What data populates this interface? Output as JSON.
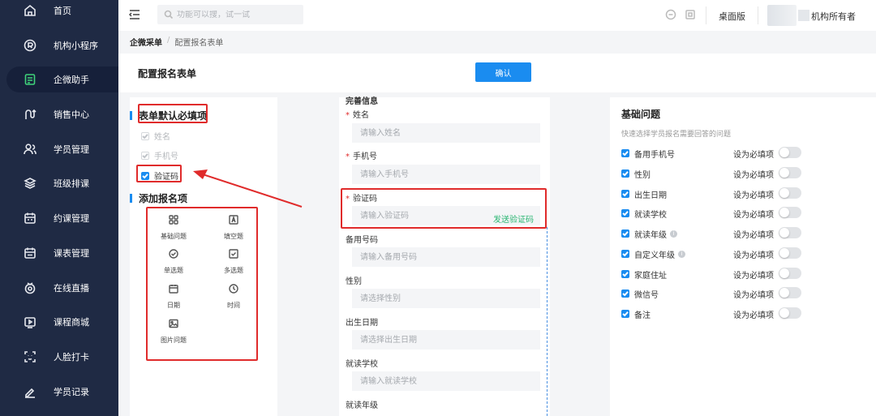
{
  "sidebar": {
    "items": [
      {
        "label": "首页",
        "icon": "home-icon"
      },
      {
        "label": "机构小程序",
        "icon": "mini-program-icon"
      },
      {
        "label": "企微助手",
        "icon": "assistant-icon",
        "active": true
      },
      {
        "label": "销售中心",
        "icon": "sales-icon"
      },
      {
        "label": "学员管理",
        "icon": "students-icon"
      },
      {
        "label": "班级排课",
        "icon": "class-icon"
      },
      {
        "label": "约课管理",
        "icon": "booking-icon"
      },
      {
        "label": "课表管理",
        "icon": "calendar-icon"
      },
      {
        "label": "在线直播",
        "icon": "live-icon"
      },
      {
        "label": "课程商城",
        "icon": "mall-icon"
      },
      {
        "label": "人脸打卡",
        "icon": "face-scan-icon"
      },
      {
        "label": "学员记录",
        "icon": "record-icon"
      }
    ]
  },
  "topbar": {
    "search_placeholder": "功能可以搜，试一试",
    "desktop_label": "桌面版",
    "owner_label": "机构所有者"
  },
  "breadcrumb": {
    "first": "企微采单",
    "sep": "/",
    "current": "配置报名表单"
  },
  "header": {
    "title": "配置报名表单",
    "confirm_label": "确认"
  },
  "left": {
    "required_title": "表单默认必填项",
    "required_items": [
      {
        "label": "姓名",
        "state": "disabled"
      },
      {
        "label": "手机号",
        "state": "disabled"
      },
      {
        "label": "验证码",
        "state": "checked"
      }
    ],
    "add_title": "添加报名项",
    "tools": [
      {
        "label": "基础问题",
        "icon": "grid-icon"
      },
      {
        "label": "填空题",
        "icon": "text-box-icon"
      },
      {
        "label": "单选题",
        "icon": "radio-circle-icon"
      },
      {
        "label": "多选题",
        "icon": "checkbox-icon"
      },
      {
        "label": "日期",
        "icon": "date-icon"
      },
      {
        "label": "时间",
        "icon": "clock-icon"
      },
      {
        "label": "图片问题",
        "icon": "image-icon"
      }
    ]
  },
  "form": {
    "head": "完善信息",
    "fields": [
      {
        "label": "姓名",
        "required": true,
        "placeholder": "请输入姓名"
      },
      {
        "label": "手机号",
        "required": true,
        "placeholder": "请输入手机号"
      },
      {
        "label": "验证码",
        "required": true,
        "placeholder": "请输入验证码"
      },
      {
        "label": "备用号码",
        "required": false,
        "placeholder": "请输入备用号码"
      },
      {
        "label": "性别",
        "required": false,
        "placeholder": "请选择性别"
      },
      {
        "label": "出生日期",
        "required": false,
        "placeholder": "请选择出生日期"
      },
      {
        "label": "就读学校",
        "required": false,
        "placeholder": "请输入就读学校"
      },
      {
        "label": "就读年级",
        "required": false,
        "placeholder": ""
      }
    ],
    "required_mark": "*",
    "send_code_label": "发送验证码"
  },
  "basic": {
    "title": "基础问题",
    "subtitle": "快速选择学员报名需要回答的问题",
    "set_required_label": "设为必填项",
    "info_mark": "i",
    "questions": [
      {
        "label": "备用手机号",
        "info": false
      },
      {
        "label": "性别",
        "info": false
      },
      {
        "label": "出生日期",
        "info": false
      },
      {
        "label": "就读学校",
        "info": false
      },
      {
        "label": "就读年级",
        "info": true
      },
      {
        "label": "自定义年级",
        "info": true
      },
      {
        "label": "家庭住址",
        "info": false
      },
      {
        "label": "微信号",
        "info": false
      },
      {
        "label": "备注",
        "info": false
      }
    ]
  },
  "colors": {
    "sidebar_bg": "#1f2a44",
    "accent_blue": "#1a8cf0",
    "active_green": "#3fd27a",
    "annotation_red": "#e02b2b",
    "send_code_green": "#2bb673"
  }
}
